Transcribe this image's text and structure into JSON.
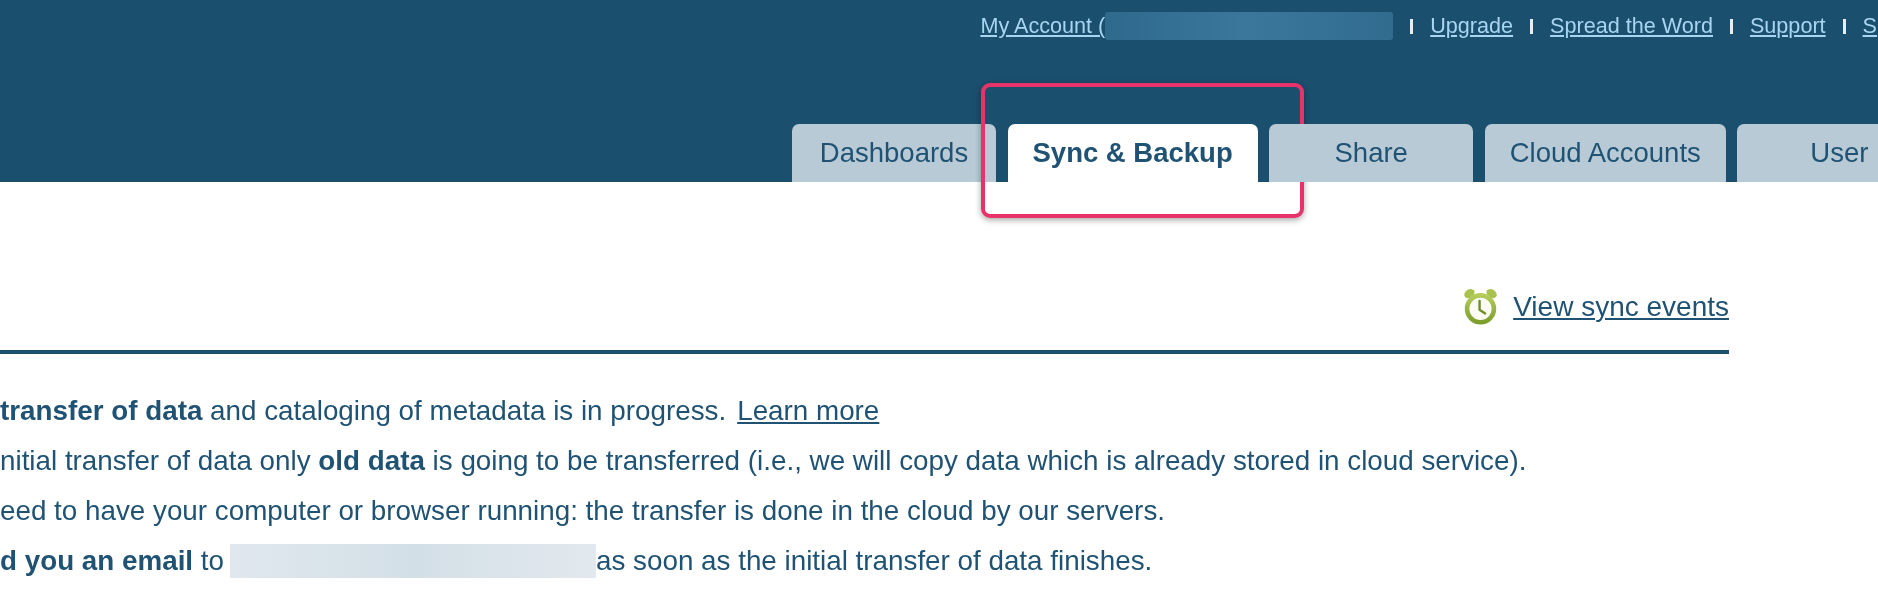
{
  "header": {
    "top_links": [
      {
        "label": "My Account (",
        "redacted_after": true
      },
      {
        "label": "Upgrade",
        "redacted_after": false
      },
      {
        "label": "Spread the Word",
        "redacted_after": false
      },
      {
        "label": "Support",
        "redacted_after": false
      },
      {
        "label": "S",
        "redacted_after": false
      }
    ]
  },
  "tabs": [
    {
      "label": "Dashboards",
      "selected": false,
      "highlighted": false
    },
    {
      "label": "Sync & Backup",
      "selected": true,
      "highlighted": true
    },
    {
      "label": "Share",
      "selected": false,
      "highlighted": false
    },
    {
      "label": "Cloud Accounts",
      "selected": false,
      "highlighted": false
    },
    {
      "label": "User",
      "selected": false,
      "highlighted": false
    }
  ],
  "sync_events_link": {
    "label": "View sync events"
  },
  "info_lines": [
    {
      "text": "**transfer of data** and cataloging of metadata is in progress.",
      "link": "Learn more",
      "redacted_after": false
    },
    {
      "text": "nitial transfer of data only **old data** is going to be transferred (i.e., we will copy data which is already stored in cloud service).",
      "redacted_after": false
    },
    {
      "text": "eed to have your computer or browser running: the transfer is done in the cloud by our servers.",
      "redacted_after": false
    },
    {
      "text": "**d you an email** to",
      "redacted_after": true,
      "text_after": "as soon as the initial transfer of data finishes."
    }
  ]
}
